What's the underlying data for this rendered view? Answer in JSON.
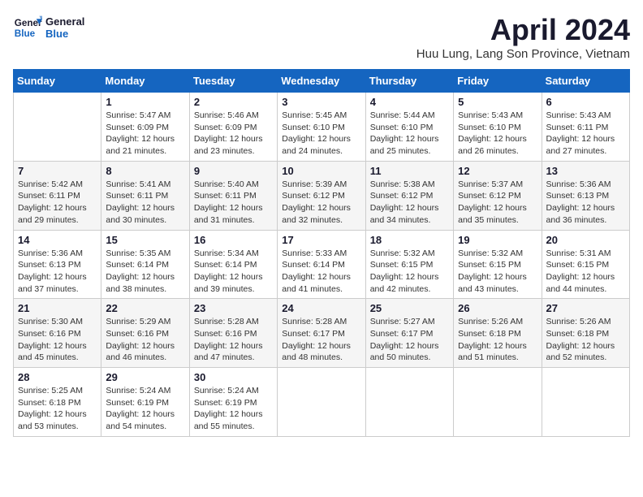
{
  "logo": {
    "line1": "General",
    "line2": "Blue"
  },
  "title": "April 2024",
  "subtitle": "Huu Lung, Lang Son Province, Vietnam",
  "days_of_week": [
    "Sunday",
    "Monday",
    "Tuesday",
    "Wednesday",
    "Thursday",
    "Friday",
    "Saturday"
  ],
  "weeks": [
    [
      {
        "num": "",
        "info": ""
      },
      {
        "num": "1",
        "info": "Sunrise: 5:47 AM\nSunset: 6:09 PM\nDaylight: 12 hours\nand 21 minutes."
      },
      {
        "num": "2",
        "info": "Sunrise: 5:46 AM\nSunset: 6:09 PM\nDaylight: 12 hours\nand 23 minutes."
      },
      {
        "num": "3",
        "info": "Sunrise: 5:45 AM\nSunset: 6:10 PM\nDaylight: 12 hours\nand 24 minutes."
      },
      {
        "num": "4",
        "info": "Sunrise: 5:44 AM\nSunset: 6:10 PM\nDaylight: 12 hours\nand 25 minutes."
      },
      {
        "num": "5",
        "info": "Sunrise: 5:43 AM\nSunset: 6:10 PM\nDaylight: 12 hours\nand 26 minutes."
      },
      {
        "num": "6",
        "info": "Sunrise: 5:43 AM\nSunset: 6:11 PM\nDaylight: 12 hours\nand 27 minutes."
      }
    ],
    [
      {
        "num": "7",
        "info": "Sunrise: 5:42 AM\nSunset: 6:11 PM\nDaylight: 12 hours\nand 29 minutes."
      },
      {
        "num": "8",
        "info": "Sunrise: 5:41 AM\nSunset: 6:11 PM\nDaylight: 12 hours\nand 30 minutes."
      },
      {
        "num": "9",
        "info": "Sunrise: 5:40 AM\nSunset: 6:11 PM\nDaylight: 12 hours\nand 31 minutes."
      },
      {
        "num": "10",
        "info": "Sunrise: 5:39 AM\nSunset: 6:12 PM\nDaylight: 12 hours\nand 32 minutes."
      },
      {
        "num": "11",
        "info": "Sunrise: 5:38 AM\nSunset: 6:12 PM\nDaylight: 12 hours\nand 34 minutes."
      },
      {
        "num": "12",
        "info": "Sunrise: 5:37 AM\nSunset: 6:12 PM\nDaylight: 12 hours\nand 35 minutes."
      },
      {
        "num": "13",
        "info": "Sunrise: 5:36 AM\nSunset: 6:13 PM\nDaylight: 12 hours\nand 36 minutes."
      }
    ],
    [
      {
        "num": "14",
        "info": "Sunrise: 5:36 AM\nSunset: 6:13 PM\nDaylight: 12 hours\nand 37 minutes."
      },
      {
        "num": "15",
        "info": "Sunrise: 5:35 AM\nSunset: 6:14 PM\nDaylight: 12 hours\nand 38 minutes."
      },
      {
        "num": "16",
        "info": "Sunrise: 5:34 AM\nSunset: 6:14 PM\nDaylight: 12 hours\nand 39 minutes."
      },
      {
        "num": "17",
        "info": "Sunrise: 5:33 AM\nSunset: 6:14 PM\nDaylight: 12 hours\nand 41 minutes."
      },
      {
        "num": "18",
        "info": "Sunrise: 5:32 AM\nSunset: 6:15 PM\nDaylight: 12 hours\nand 42 minutes."
      },
      {
        "num": "19",
        "info": "Sunrise: 5:32 AM\nSunset: 6:15 PM\nDaylight: 12 hours\nand 43 minutes."
      },
      {
        "num": "20",
        "info": "Sunrise: 5:31 AM\nSunset: 6:15 PM\nDaylight: 12 hours\nand 44 minutes."
      }
    ],
    [
      {
        "num": "21",
        "info": "Sunrise: 5:30 AM\nSunset: 6:16 PM\nDaylight: 12 hours\nand 45 minutes."
      },
      {
        "num": "22",
        "info": "Sunrise: 5:29 AM\nSunset: 6:16 PM\nDaylight: 12 hours\nand 46 minutes."
      },
      {
        "num": "23",
        "info": "Sunrise: 5:28 AM\nSunset: 6:16 PM\nDaylight: 12 hours\nand 47 minutes."
      },
      {
        "num": "24",
        "info": "Sunrise: 5:28 AM\nSunset: 6:17 PM\nDaylight: 12 hours\nand 48 minutes."
      },
      {
        "num": "25",
        "info": "Sunrise: 5:27 AM\nSunset: 6:17 PM\nDaylight: 12 hours\nand 50 minutes."
      },
      {
        "num": "26",
        "info": "Sunrise: 5:26 AM\nSunset: 6:18 PM\nDaylight: 12 hours\nand 51 minutes."
      },
      {
        "num": "27",
        "info": "Sunrise: 5:26 AM\nSunset: 6:18 PM\nDaylight: 12 hours\nand 52 minutes."
      }
    ],
    [
      {
        "num": "28",
        "info": "Sunrise: 5:25 AM\nSunset: 6:18 PM\nDaylight: 12 hours\nand 53 minutes."
      },
      {
        "num": "29",
        "info": "Sunrise: 5:24 AM\nSunset: 6:19 PM\nDaylight: 12 hours\nand 54 minutes."
      },
      {
        "num": "30",
        "info": "Sunrise: 5:24 AM\nSunset: 6:19 PM\nDaylight: 12 hours\nand 55 minutes."
      },
      {
        "num": "",
        "info": ""
      },
      {
        "num": "",
        "info": ""
      },
      {
        "num": "",
        "info": ""
      },
      {
        "num": "",
        "info": ""
      }
    ]
  ]
}
